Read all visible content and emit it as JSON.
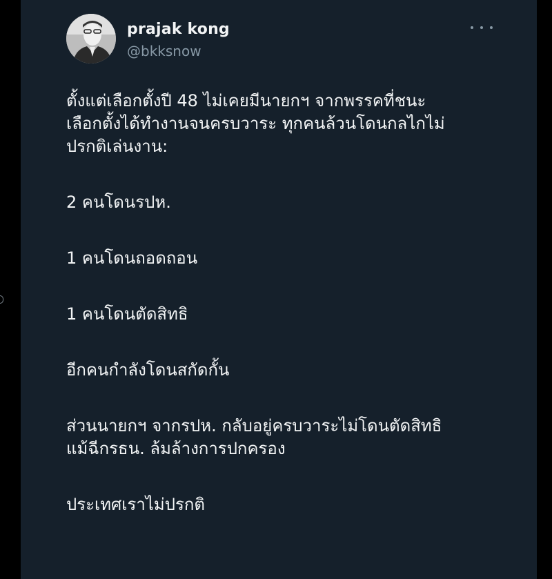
{
  "user": {
    "display_name": "prajak kong",
    "handle": "@bkksnow",
    "avatar_icon": "profile-photo-grayscale-man-in-suit"
  },
  "menu": {
    "icon": "more-horizontal-icon"
  },
  "tweet": {
    "paragraphs": [
      [
        "ตั้งแต่เลือกตั้งปี 48 ไม่เคยมีนายกฯ จากพรรคที่ชนะ",
        "เลือกตั้งได้ทำงานจนครบวาระ ทุกคนล้วนโดนกลไกไม่",
        "ปรกติเล่นงาน:"
      ],
      [
        "2 คนโดนรปห."
      ],
      [
        "1 คนโดนถอดถอน"
      ],
      [
        "1 คนโดนตัดสิทธิ"
      ],
      [
        "อีกคนกำลังโดนสกัดกั้น"
      ],
      [
        "ส่วนนายกฯ จากรปห. กลับอยู่ครบวาระไม่โดนตัดสิทธิ",
        "แม้ฉีกรธน. ล้มล้างการปกครอง"
      ],
      [
        "ประเทศเราไม่ปรกติ"
      ]
    ]
  },
  "colors": {
    "card_background": "#15202b",
    "outer_background": "#000000",
    "primary_text": "#f2f4f5",
    "secondary_text": "#8899a6"
  }
}
